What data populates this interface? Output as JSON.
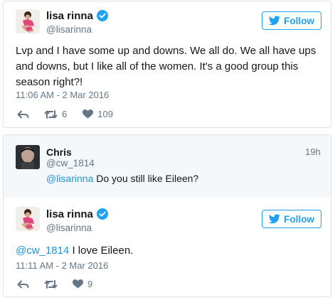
{
  "tweet1": {
    "name": "lisa rinna",
    "handle": "@lisarinna",
    "follow_label": "Follow",
    "text": "Lvp and I have some up and downs. We all do. We all have ups and downs, but I like all of the women. It's a good group this season right?!",
    "timestamp": "11:06 AM - 2 Mar 2016",
    "retweets": "6",
    "likes": "109"
  },
  "reply": {
    "name": "Chris",
    "handle": "@cw_1814",
    "time_ago": "19h",
    "mention": "@lisarinna",
    "text": "Do you still like Eileen?"
  },
  "tweet2": {
    "name": "lisa rinna",
    "handle": "@lisarinna",
    "follow_label": "Follow",
    "mention": "@cw_1814",
    "text": "I love Eileen.",
    "timestamp": "11:11 AM - 2 Mar 2016",
    "likes": "9"
  },
  "colors": {
    "accent": "#1da1f2",
    "like_gray": "#657786",
    "text": "#14171a",
    "mention": "#1b95e0",
    "reply_bg": "#f5f8fa"
  },
  "icons": [
    "verified-badge-icon",
    "twitter-bird-icon",
    "reply-icon",
    "retweet-icon",
    "heart-icon"
  ]
}
